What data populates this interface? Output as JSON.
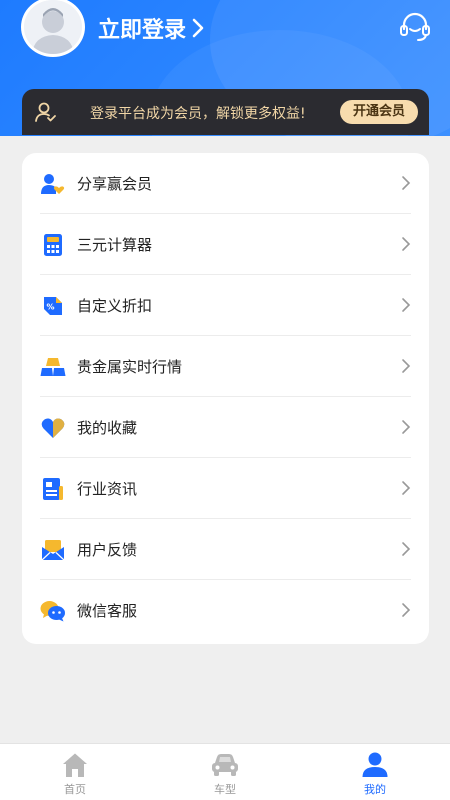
{
  "header": {
    "login_label": "立即登录",
    "avatar_icon": "default-avatar-icon",
    "service_icon": "customer-service-headset-icon"
  },
  "vip_banner": {
    "text": "登录平台成为会员，解锁更多权益!",
    "button_label": "开通会员",
    "icon": "member-user-icon"
  },
  "menu": {
    "items": [
      {
        "label": "分享赢会员",
        "icon": "share-member-icon"
      },
      {
        "label": "三元计算器",
        "icon": "calculator-icon"
      },
      {
        "label": "自定义折扣",
        "icon": "discount-tag-icon"
      },
      {
        "label": "贵金属实时行情",
        "icon": "gold-bars-icon"
      },
      {
        "label": "我的收藏",
        "icon": "heart-icon"
      },
      {
        "label": "行业资讯",
        "icon": "news-icon"
      },
      {
        "label": "用户反馈",
        "icon": "feedback-mail-icon"
      },
      {
        "label": "微信客服",
        "icon": "wechat-icon"
      }
    ]
  },
  "tabbar": {
    "tabs": [
      {
        "label": "首页",
        "icon": "home-icon",
        "active": false
      },
      {
        "label": "车型",
        "icon": "car-icon",
        "active": false
      },
      {
        "label": "我的",
        "icon": "profile-icon",
        "active": true
      }
    ]
  },
  "colors": {
    "header_blue": "#1e7bff",
    "vip_bar": "#2b2b30",
    "vip_gold": "#f7dcae",
    "active_tab": "#1f6bff"
  }
}
